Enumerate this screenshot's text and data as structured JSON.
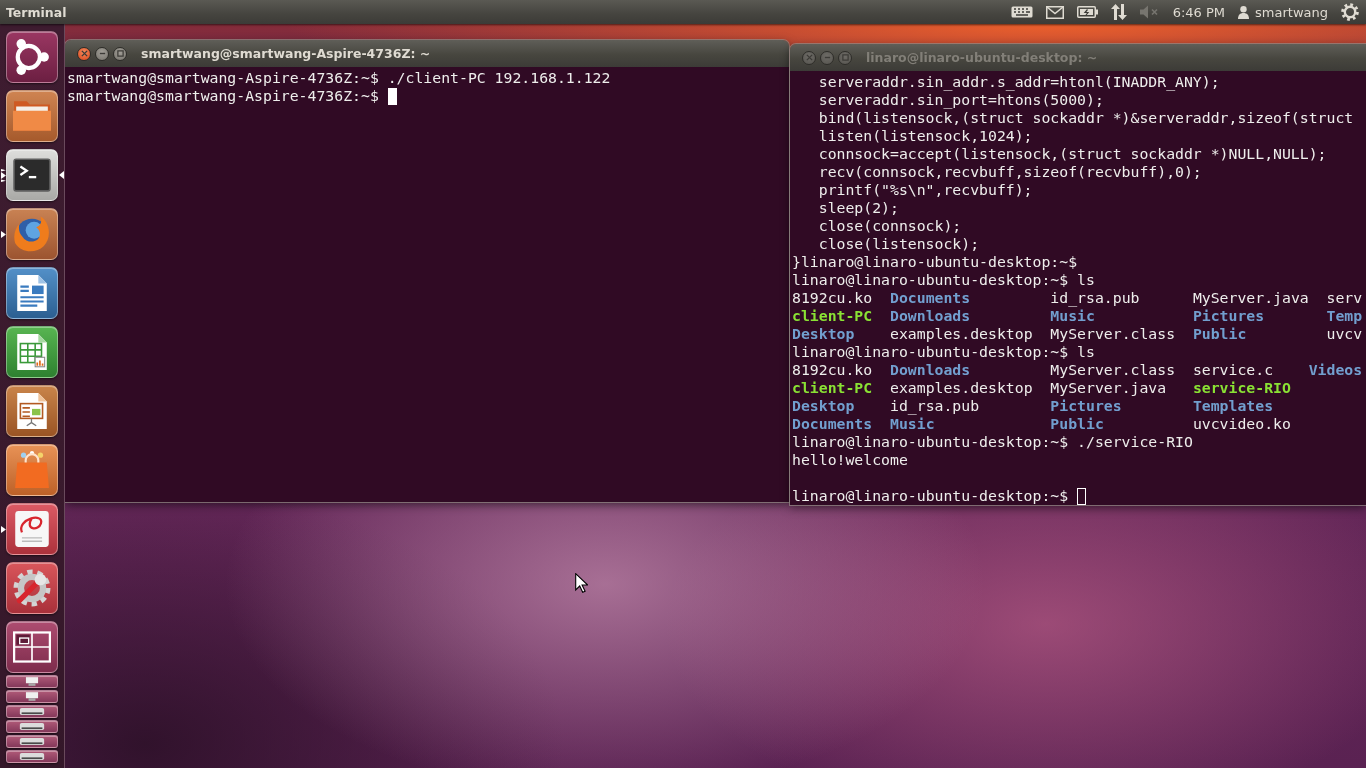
{
  "top_panel": {
    "app_name": "Terminal",
    "sound": {
      "muted": true
    },
    "clock": "6:46 PM",
    "user": "smartwang"
  },
  "launcher": [
    {
      "kind": "dash",
      "running": false,
      "focused": false,
      "several_windows": false,
      "folded": false
    },
    {
      "kind": "folder",
      "running": false,
      "focused": false,
      "several_windows": false,
      "folded": false
    },
    {
      "kind": "terminal",
      "running": true,
      "focused": true,
      "several_windows": true,
      "folded": false
    },
    {
      "kind": "browser",
      "running": true,
      "focused": false,
      "several_windows": false,
      "folded": false
    },
    {
      "kind": "text-document",
      "running": false,
      "focused": false,
      "several_windows": false,
      "folded": false
    },
    {
      "kind": "spreadsheet",
      "running": false,
      "focused": false,
      "several_windows": false,
      "folded": false
    },
    {
      "kind": "presentation",
      "running": false,
      "focused": false,
      "several_windows": false,
      "folded": false
    },
    {
      "kind": "shopping-bag",
      "running": false,
      "focused": false,
      "several_windows": false,
      "folded": false
    },
    {
      "kind": "document-viewer",
      "running": true,
      "focused": false,
      "several_windows": false,
      "folded": false
    },
    {
      "kind": "settings",
      "running": false,
      "focused": false,
      "several_windows": false,
      "folded": false
    },
    {
      "kind": "workspaces",
      "running": false,
      "focused": false,
      "several_windows": false,
      "folded": false
    },
    {
      "kind": "usb-drive",
      "running": false,
      "focused": false,
      "several_windows": false,
      "folded": true
    },
    {
      "kind": "usb-drive",
      "running": false,
      "focused": false,
      "several_windows": false,
      "folded": true
    },
    {
      "kind": "disk-drive",
      "running": false,
      "focused": false,
      "several_windows": false,
      "folded": true
    },
    {
      "kind": "disk-drive",
      "running": false,
      "focused": false,
      "several_windows": false,
      "folded": true
    },
    {
      "kind": "disk-drive",
      "running": false,
      "focused": false,
      "several_windows": false,
      "folded": true
    },
    {
      "kind": "disk-drive",
      "running": false,
      "focused": false,
      "several_windows": false,
      "folded": true
    }
  ],
  "windows": [
    {
      "title": "smartwang@smartwang-Aspire-4736Z: ~",
      "focused": true,
      "lines": [
        {
          "kind": "prompt",
          "text": "smartwang@smartwang-Aspire-4736Z:~$ ./client-PC 192.168.1.122"
        }
      ],
      "current_prompt": "smartwang@smartwang-Aspire-4736Z:~$"
    },
    {
      "title": "linaro@linaro-ubuntu-desktop: ~",
      "focused": false,
      "lines": [
        {
          "kind": "code",
          "text": "serveraddr.sin_addr.s_addr=htonl(INADDR_ANY);"
        },
        {
          "kind": "code",
          "text": "serveraddr.sin_port=htons(5000);"
        },
        {
          "kind": "code",
          "text": "bind(listensock,(struct sockaddr *)&serveraddr,sizeof(struct"
        },
        {
          "kind": "code",
          "text": "listen(listensock,1024);"
        },
        {
          "kind": "code",
          "text": "connsock=accept(listensock,(struct sockaddr *)NULL,NULL);"
        },
        {
          "kind": "code",
          "text": "recv(connsock,recvbuff,sizeof(recvbuff),0);"
        },
        {
          "kind": "code",
          "text": "printf(\"%s\\n\",recvbuff);"
        },
        {
          "kind": "code",
          "text": "sleep(2);"
        },
        {
          "kind": "code",
          "text": "close(connsock);"
        },
        {
          "kind": "code",
          "text": "close(listensock);"
        },
        {
          "kind": "prompt",
          "text": "}linaro@linaro-ubuntu-desktop:~$"
        },
        {
          "kind": "prompt",
          "text": "linaro@linaro-ubuntu-desktop:~$ ls"
        },
        {
          "kind": "listing",
          "rows": [
            [
              {
                "name": "8192cu.ko",
                "kind": "file"
              },
              {
                "name": "Documents",
                "kind": "directory"
              },
              {
                "name": "id_rsa.pub",
                "kind": "file"
              },
              {
                "name": "MyServer.java",
                "kind": "file"
              },
              {
                "name": "serv",
                "kind": "file"
              }
            ],
            [
              {
                "name": "client-PC",
                "kind": "executable"
              },
              {
                "name": "Downloads",
                "kind": "directory"
              },
              {
                "name": "Music",
                "kind": "directory"
              },
              {
                "name": "Pictures",
                "kind": "directory"
              },
              {
                "name": "Temp",
                "kind": "directory"
              }
            ],
            [
              {
                "name": "Desktop",
                "kind": "directory"
              },
              {
                "name": "examples.desktop",
                "kind": "file"
              },
              {
                "name": "MyServer.class",
                "kind": "file"
              },
              {
                "name": "Public",
                "kind": "directory"
              },
              {
                "name": "uvcv",
                "kind": "file"
              }
            ]
          ]
        },
        {
          "kind": "prompt",
          "text": "linaro@linaro-ubuntu-desktop:~$ ls"
        },
        {
          "kind": "listing",
          "rows": [
            [
              {
                "name": "8192cu.ko",
                "kind": "file"
              },
              {
                "name": "Downloads",
                "kind": "directory"
              },
              {
                "name": "MyServer.class",
                "kind": "file"
              },
              {
                "name": "service.c",
                "kind": "file"
              },
              {
                "name": "Videos",
                "kind": "directory"
              }
            ],
            [
              {
                "name": "client-PC",
                "kind": "executable"
              },
              {
                "name": "examples.desktop",
                "kind": "file"
              },
              {
                "name": "MyServer.java",
                "kind": "file"
              },
              {
                "name": "service-RIO",
                "kind": "executable"
              }
            ],
            [
              {
                "name": "Desktop",
                "kind": "directory"
              },
              {
                "name": "id_rsa.pub",
                "kind": "file"
              },
              {
                "name": "Pictures",
                "kind": "directory"
              },
              {
                "name": "Templates",
                "kind": "directory"
              }
            ],
            [
              {
                "name": "Documents",
                "kind": "directory"
              },
              {
                "name": "Music",
                "kind": "directory"
              },
              {
                "name": "Public",
                "kind": "directory"
              },
              {
                "name": "uvcvideo.ko",
                "kind": "file"
              }
            ]
          ]
        },
        {
          "kind": "prompt",
          "text": "linaro@linaro-ubuntu-desktop:~$ ./service-RIO"
        },
        {
          "kind": "output",
          "text": "hello!welcome"
        },
        {
          "kind": "blank"
        }
      ],
      "current_prompt": "linaro@linaro-ubuntu-desktop:~$"
    }
  ]
}
